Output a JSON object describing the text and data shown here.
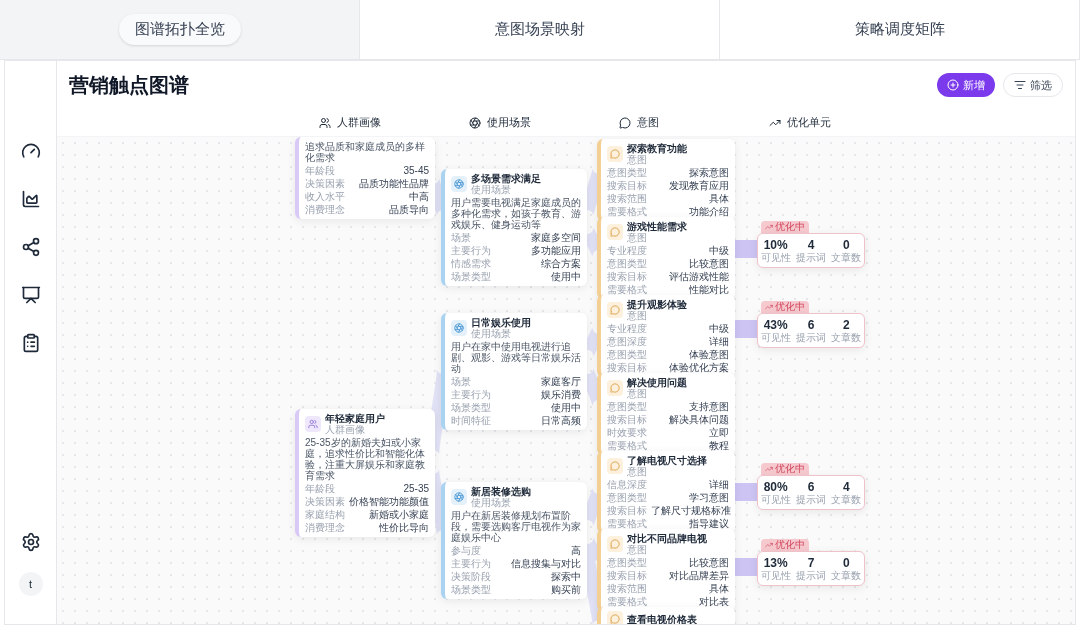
{
  "tabs": [
    {
      "label": "图谱拓扑全览",
      "selected": true
    },
    {
      "label": "意图场景映射",
      "selected": false
    },
    {
      "label": "策略调度矩阵",
      "selected": false
    }
  ],
  "sidebar": {
    "avatar": "t"
  },
  "page": {
    "title": "营销触点图谱",
    "buttons": [
      {
        "label": "新增",
        "kind": "primary"
      },
      {
        "label": "筛选",
        "kind": "secondary"
      }
    ]
  },
  "columns": [
    {
      "label": "人群画像",
      "kind": "persona"
    },
    {
      "label": "使用场景",
      "kind": "scenario"
    },
    {
      "label": "意图",
      "kind": "intent"
    },
    {
      "label": "优化单元",
      "kind": "optimization"
    }
  ],
  "personas": [
    {
      "description": "追求品质和家庭成员的多样化需求",
      "rows": [
        [
          "年龄段",
          "35-45"
        ],
        [
          "决策因素",
          "品质功能性品牌"
        ],
        [
          "收入水平",
          "中高"
        ],
        [
          "消费理念",
          "品质导向"
        ]
      ]
    },
    {
      "title": "年轻家庭用户",
      "subtitle": "人群画像",
      "description": "25-35岁的新婚夫妇或小家庭，追求性价比和智能化体验，注重大屏娱乐和家庭教育需求",
      "rows": [
        [
          "年龄段",
          "25-35"
        ],
        [
          "决策因素",
          "价格智能功能颜值"
        ],
        [
          "家庭结构",
          "新婚或小家庭"
        ],
        [
          "消费理念",
          "性价比导向"
        ]
      ]
    }
  ],
  "scenarios": [
    {
      "title": "多场景需求满足",
      "subtitle": "使用场景",
      "description": "用户需要电视满足家庭成员的多种化需求，如孩子教育、游戏娱乐、健身运动等",
      "rows": [
        [
          "场景",
          "家庭多空间"
        ],
        [
          "主要行为",
          "多功能应用"
        ],
        [
          "情感需求",
          "综合方案"
        ],
        [
          "场景类型",
          "使用中"
        ]
      ]
    },
    {
      "title": "日常娱乐使用",
      "subtitle": "使用场景",
      "description": "用户在家中使用电视进行追剧、观影、游戏等日常娱乐活动",
      "rows": [
        [
          "场景",
          "家庭客厅"
        ],
        [
          "主要行为",
          "娱乐消费"
        ],
        [
          "场景类型",
          "使用中"
        ],
        [
          "时间特征",
          "日常高频"
        ]
      ]
    },
    {
      "title": "新居装修选购",
      "subtitle": "使用场景",
      "description": "用户在新居装修规划布置阶段，需要选购客厅电视作为家庭娱乐中心",
      "rows": [
        [
          "参与度",
          "高"
        ],
        [
          "主要行为",
          "信息搜集与对比"
        ],
        [
          "决策阶段",
          "探索中"
        ],
        [
          "场景类型",
          "购买前"
        ]
      ]
    }
  ],
  "intents": [
    {
      "title": "探索教育功能",
      "subtitle": "意图",
      "rows": [
        [
          "意图类型",
          "探索意图"
        ],
        [
          "搜索目标",
          "发现教育应用"
        ],
        [
          "搜索范围",
          "具体"
        ],
        [
          "需要格式",
          "功能介绍"
        ]
      ]
    },
    {
      "title": "游戏性能需求",
      "subtitle": "意图",
      "rows": [
        [
          "专业程度",
          "中级"
        ],
        [
          "意图类型",
          "比较意图"
        ],
        [
          "搜索目标",
          "评估游戏性能"
        ],
        [
          "需要格式",
          "性能对比"
        ]
      ]
    },
    {
      "title": "提升观影体验",
      "subtitle": "意图",
      "rows": [
        [
          "专业程度",
          "中级"
        ],
        [
          "意图深度",
          "详细"
        ],
        [
          "意图类型",
          "体验意图"
        ],
        [
          "搜索目标",
          "体验优化方案"
        ]
      ]
    },
    {
      "title": "解决使用问题",
      "subtitle": "意图",
      "rows": [
        [
          "意图类型",
          "支持意图"
        ],
        [
          "搜索目标",
          "解决具体问题"
        ],
        [
          "时效要求",
          "立即"
        ],
        [
          "需要格式",
          "教程"
        ]
      ]
    },
    {
      "title": "了解电视尺寸选择",
      "subtitle": "意图",
      "rows": [
        [
          "信息深度",
          "详细"
        ],
        [
          "意图类型",
          "学习意图"
        ],
        [
          "搜索目标",
          "了解尺寸规格标准"
        ],
        [
          "需要格式",
          "指导建议"
        ]
      ]
    },
    {
      "title": "对比不同品牌电视",
      "subtitle": "意图",
      "rows": [
        [
          "意图类型",
          "比较意图"
        ],
        [
          "搜索目标",
          "对比品牌差异"
        ],
        [
          "搜索范围",
          "具体"
        ],
        [
          "需要格式",
          "对比表"
        ]
      ]
    },
    {
      "title": "查看电视价格表"
    }
  ],
  "optimizations": [
    {
      "badge": "优化中",
      "metrics": [
        {
          "value": "10%",
          "label": "可见性"
        },
        {
          "value": "4",
          "label": "提示词"
        },
        {
          "value": "0",
          "label": "文章数"
        }
      ]
    },
    {
      "badge": "优化中",
      "metrics": [
        {
          "value": "43%",
          "label": "可见性"
        },
        {
          "value": "6",
          "label": "提示词"
        },
        {
          "value": "2",
          "label": "文章数"
        }
      ]
    },
    {
      "badge": "优化中",
      "metrics": [
        {
          "value": "80%",
          "label": "可见性"
        },
        {
          "value": "6",
          "label": "提示词"
        },
        {
          "value": "4",
          "label": "文章数"
        }
      ]
    },
    {
      "badge": "优化中",
      "metrics": [
        {
          "value": "13%",
          "label": "可见性"
        },
        {
          "value": "7",
          "label": "提示词"
        },
        {
          "value": "0",
          "label": "文章数"
        }
      ]
    }
  ]
}
